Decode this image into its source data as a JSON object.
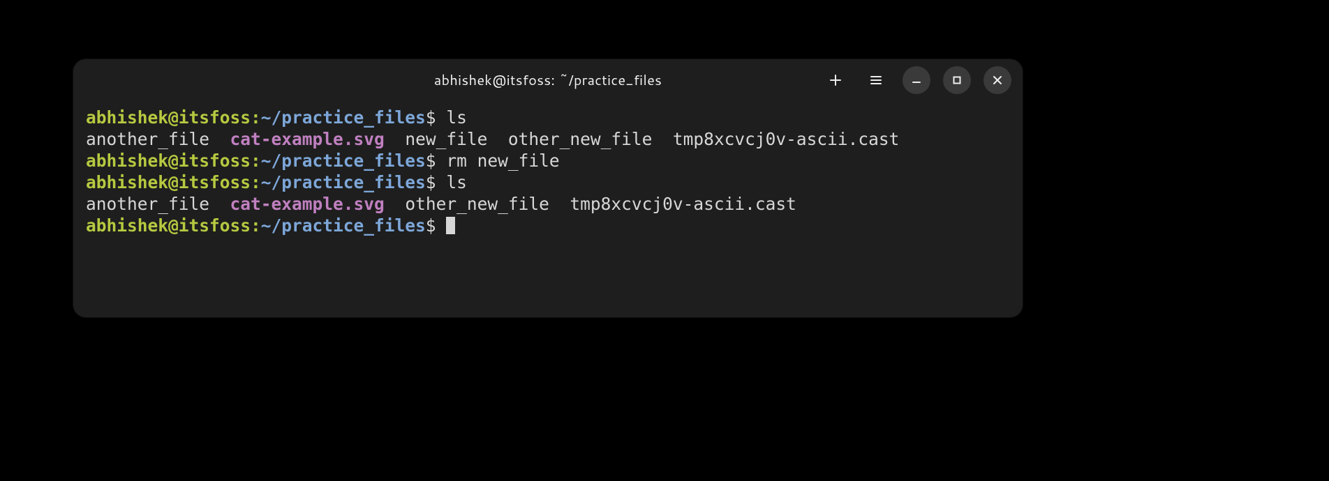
{
  "window": {
    "title": "abhishek@itsfoss: ~/practice_files"
  },
  "prompt": {
    "user_host": "abhishek@itsfoss",
    "colon": ":",
    "path": "~/practice_files",
    "dollar": "$"
  },
  "lines": {
    "l1_cmd": "ls",
    "l2_f1": "another_file",
    "l2_s1": "  ",
    "l2_f2": "cat-example.svg",
    "l2_s2": "  ",
    "l2_f3": "new_file",
    "l2_s3": "  ",
    "l2_f4": "other_new_file",
    "l2_s4": "  ",
    "l2_f5": "tmp8xcvcj0v-ascii.cast",
    "l3_cmd": "rm new_file",
    "l4_cmd": "ls",
    "l5_f1": "another_file",
    "l5_s1": "  ",
    "l5_f2": "cat-example.svg",
    "l5_s2": "  ",
    "l5_f3": "other_new_file",
    "l5_s3": "  ",
    "l5_f4": "tmp8xcvcj0v-ascii.cast"
  }
}
